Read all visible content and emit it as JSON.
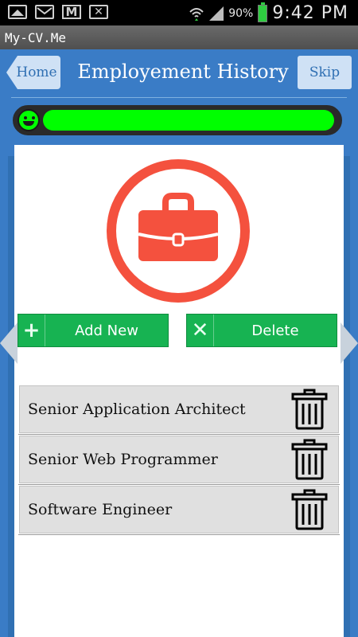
{
  "status_bar": {
    "battery": "90%",
    "time": "9:42 PM",
    "icons_left": [
      "image-icon",
      "mail-icon",
      "gmail-icon",
      "missed-call-icon"
    ],
    "icons_right": [
      "wifi-icon",
      "signal-icon",
      "battery-icon"
    ]
  },
  "app": {
    "name": "My-CV.Me"
  },
  "header": {
    "home_label": "Home",
    "title": "Employement History",
    "skip_label": "Skip"
  },
  "progress": {
    "percent": 100,
    "color": "#00ff00"
  },
  "actions": {
    "add_label": "Add New",
    "delete_label": "Delete"
  },
  "jobs": [
    {
      "title": "Senior Application Architect"
    },
    {
      "title": "Senior Web Programmer"
    },
    {
      "title": "Software Engineer"
    }
  ],
  "colors": {
    "header_blue": "#3a7cc6",
    "badge_red": "#f4513e",
    "button_green": "#17b352"
  }
}
